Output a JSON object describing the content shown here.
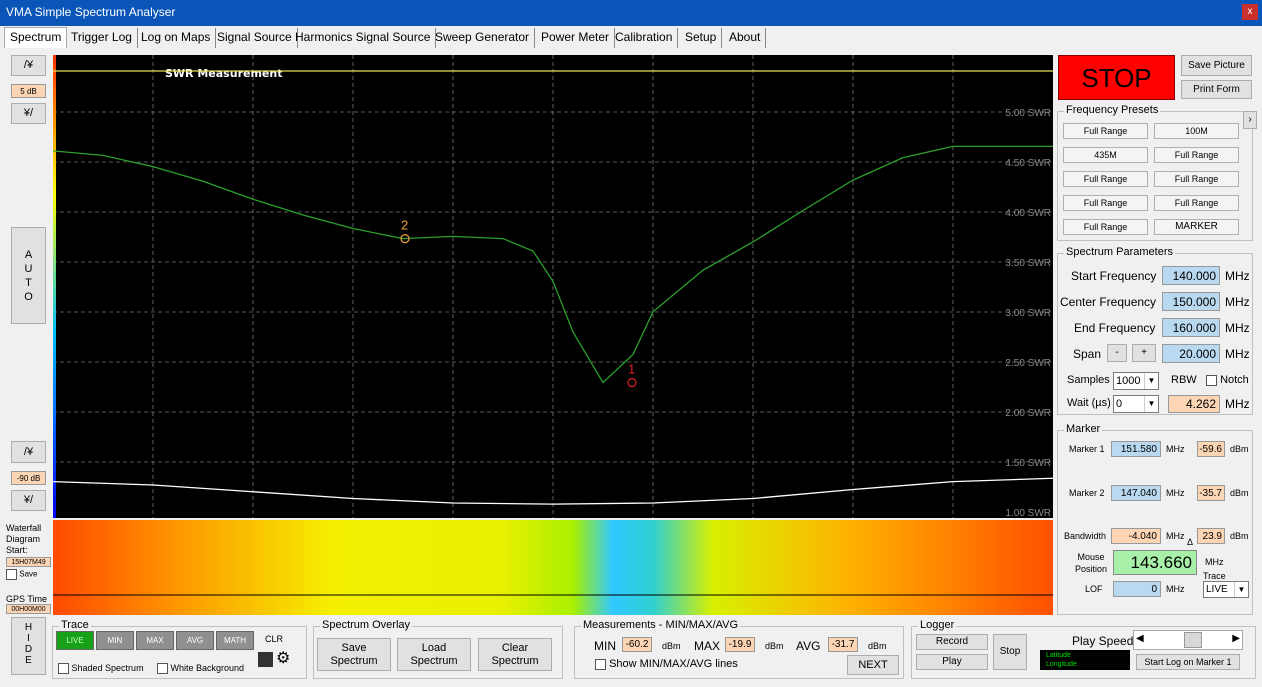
{
  "window": {
    "title": "VMA Simple Spectrum Analyser",
    "close": "x"
  },
  "tabs": [
    "Spectrum",
    "Trigger Log",
    "Log on Maps",
    "Signal Source",
    "Harmonics Signal Source",
    "Sweep Generator",
    "Power Meter",
    "Calibration",
    "Setup",
    "About"
  ],
  "left": {
    "up_top": "/¥",
    "db_step": "5 dB",
    "down_top": "¥/",
    "auto": "A U T O",
    "up_bottom": "/¥",
    "db_ref": "-90 dB",
    "down_bottom": "¥/",
    "waterfall_label": "Waterfall Diagram Start:",
    "waterfall_start": "15H07M49",
    "save_label": "Save",
    "gps_label": "GPS Time",
    "gps_value": "00H00M00",
    "hide": "H I D E"
  },
  "chart_data": {
    "type": "line",
    "title": "SWR Measurement",
    "yticks": [
      "5.00 SWR",
      "4.50 SWR",
      "4.00 SWR",
      "3.50 SWR",
      "3.00 SWR",
      "2.50 SWR",
      "2.00 SWR",
      "1.50 SWR",
      "1.00 SWR"
    ],
    "ylim": [
      1.0,
      5.0
    ],
    "xlim": [
      140.0,
      160.0
    ],
    "series": [
      {
        "color": "#e6e04a",
        "x": [
          140,
          145,
          150,
          155,
          160
        ],
        "y": [
          4.92,
          4.92,
          4.92,
          4.92,
          4.92
        ]
      },
      {
        "color": "#2ca02c",
        "x": [
          140,
          141,
          142,
          143,
          144,
          145,
          146,
          147,
          148,
          149,
          149.6,
          150,
          150.4,
          151,
          151.6,
          152,
          153,
          154,
          155,
          156,
          157,
          158,
          159,
          160
        ],
        "y": [
          4.21,
          4.17,
          4.07,
          3.94,
          3.78,
          3.64,
          3.52,
          3.43,
          3.45,
          3.43,
          3.32,
          3.05,
          2.6,
          2.15,
          2.4,
          2.78,
          3.15,
          3.4,
          3.68,
          3.95,
          4.15,
          4.25,
          4.25,
          4.25
        ]
      },
      {
        "color": "#ffffff",
        "x": [
          140,
          142,
          144,
          146,
          148,
          150,
          152,
          154,
          156,
          158,
          160
        ],
        "y": [
          1.27,
          1.24,
          1.18,
          1.12,
          1.08,
          1.07,
          1.08,
          1.12,
          1.2,
          1.27,
          1.3
        ]
      }
    ],
    "markers": [
      {
        "label": "1",
        "x": 151.58,
        "y": 2.15,
        "color": "#e02020"
      },
      {
        "label": "2",
        "x": 147.04,
        "y": 3.43,
        "color": "#f0a040"
      }
    ]
  },
  "right": {
    "stop": "STOP",
    "save_picture": "Save Picture",
    "print_form": "Print Form",
    "presets_title": "Frequency Presets",
    "presets": [
      "Full Range",
      "100M",
      "435M",
      "Full Range",
      "Full Range",
      "Full Range",
      "Full Range",
      "Full Range",
      "Full Range",
      "MARKER"
    ],
    "params_title": "Spectrum Parameters",
    "start_label": "Start Frequency",
    "start_value": "140.000",
    "center_label": "Center Frequency",
    "center_value": "150.000",
    "end_label": "End Frequency",
    "end_value": "160.000",
    "span_label": "Span",
    "span_minus": "-",
    "span_plus": "+",
    "span_value": "20.000",
    "unit": "MHz",
    "samples_label": "Samples",
    "samples_value": "1000",
    "rbw_label": "RBW",
    "notch_label": "Notch",
    "wait_label": "Wait (µs)",
    "wait_value": "0",
    "rbw_value": "4.262",
    "marker_title": "Marker",
    "m1_label": "Marker 1",
    "m1_freq": "151.580",
    "m1_db": "-59.6",
    "m2_label": "Marker 2",
    "m2_freq": "147.040",
    "m2_db": "-35.7",
    "dbm": "dBm",
    "bw_label": "Bandwidth",
    "bw_value": "-4.040",
    "bw_db": "23.9",
    "delta": "Δ",
    "mouse_label": "Mouse Position",
    "mouse_value": "143.660",
    "trace_label": "Trace",
    "trace_value": "LIVE",
    "lof_label": "LOF",
    "lof_value": "0"
  },
  "bottom": {
    "trace_title": "Trace",
    "live": "LIVE",
    "min": "MIN",
    "max": "MAX",
    "avg": "AVG",
    "math": "MATH",
    "clr": "CLR",
    "shaded": "Shaded Spectrum",
    "white_bg": "White Background",
    "overlay_title": "Spectrum Overlay",
    "save_spectrum": "Save Spectrum",
    "load_spectrum": "Load Spectrum",
    "clear_spectrum": "Clear Spectrum",
    "meas_title": "Measurements - MIN/MAX/AVG",
    "min_label": "MIN",
    "min_value": "-60.2",
    "max_label": "MAX",
    "max_value": "-19.9",
    "avg_label": "AVG",
    "avg_value": "-31.7",
    "show_lines": "Show MIN/MAX/AVG lines",
    "next": "NEXT",
    "logger_title": "Logger",
    "record": "Record",
    "play": "Play",
    "stop": "Stop",
    "play_speed": "Play Speed",
    "latitude": "Latitude",
    "longitude": "Longitude",
    "start_log": "Start Log on Marker 1"
  }
}
